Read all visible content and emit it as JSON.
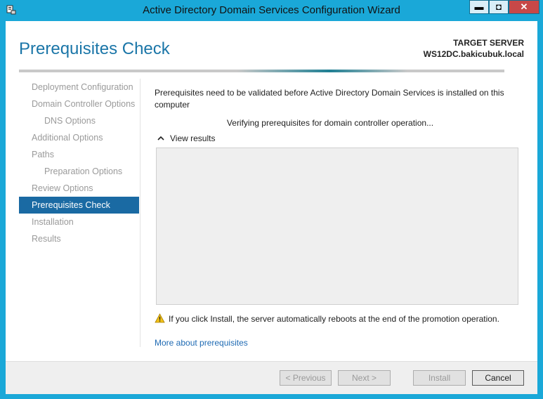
{
  "window": {
    "title": "Active Directory Domain Services Configuration Wizard",
    "minimize_glyph": "▬",
    "maximize_glyph": "◘",
    "close_glyph": "✕"
  },
  "header": {
    "page_title": "Prerequisites Check",
    "target_server_label": "TARGET SERVER",
    "target_server_name": "WS12DC.bakicubuk.local"
  },
  "nav": {
    "items": [
      {
        "label": "Deployment Configuration",
        "active": false,
        "sub": false
      },
      {
        "label": "Domain Controller Options",
        "active": false,
        "sub": false
      },
      {
        "label": "DNS Options",
        "active": false,
        "sub": true
      },
      {
        "label": "Additional Options",
        "active": false,
        "sub": false
      },
      {
        "label": "Paths",
        "active": false,
        "sub": false
      },
      {
        "label": "Preparation Options",
        "active": false,
        "sub": true
      },
      {
        "label": "Review Options",
        "active": false,
        "sub": false
      },
      {
        "label": "Prerequisites Check",
        "active": true,
        "sub": false
      },
      {
        "label": "Installation",
        "active": false,
        "sub": false
      },
      {
        "label": "Results",
        "active": false,
        "sub": false
      }
    ]
  },
  "main": {
    "intro": "Prerequisites need to be validated before Active Directory Domain Services is installed on this computer",
    "verifying": "Verifying prerequisites for domain controller operation...",
    "view_results_label": "View results",
    "warning_text": "If you click Install, the server automatically reboots at the end of the promotion operation.",
    "more_link": "More about prerequisites"
  },
  "footer": {
    "previous": "< Previous",
    "next": "Next >",
    "install": "Install",
    "cancel": "Cancel"
  },
  "colors": {
    "accent": "#1a6aa3",
    "title_blue": "#1b76a8",
    "titlebar": "#1aa8d8",
    "link": "#1e6ab3"
  },
  "icons": {
    "app": "server-manager-icon",
    "expand": "chevron-up-icon",
    "warning": "warning-icon"
  }
}
